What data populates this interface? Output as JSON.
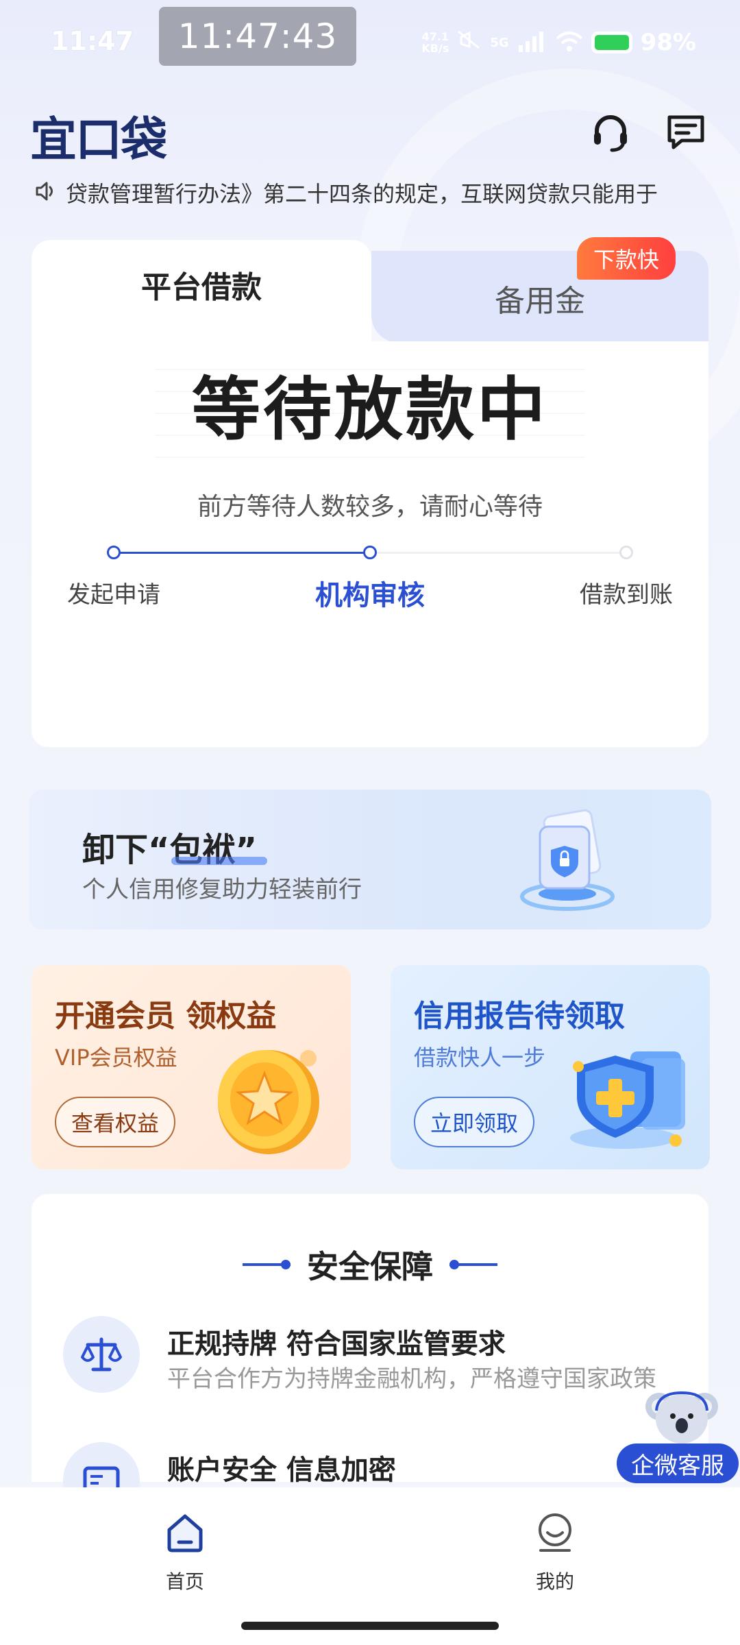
{
  "status_bar": {
    "time": "11:47",
    "clock_overlay": "11:47:43",
    "net_speed_value": "47.1",
    "net_speed_unit": "KB/s",
    "network": "5G",
    "battery": "98%"
  },
  "header": {
    "logo": "宜口袋",
    "icons": [
      "headset-icon",
      "message-icon"
    ]
  },
  "notice": {
    "text": "贷款管理暂行办法》第二十四条的规定，互联网贷款只能用于"
  },
  "loan_card": {
    "tabs": [
      {
        "label": "平台借款",
        "active": true
      },
      {
        "label": "备用金",
        "active": false,
        "badge": "下款快"
      }
    ],
    "status_title": "等待放款中",
    "status_subtitle": "前方等待人数较多，请耐心等待",
    "progress": {
      "steps": [
        "发起申请",
        "机构审核",
        "借款到账"
      ],
      "current_step": 2
    }
  },
  "banner": {
    "title": "卸下“包袱”",
    "subtitle": "个人信用修复助力轻装前行"
  },
  "promos": [
    {
      "title": "开通会员 领权益",
      "subtitle": "VIP会员权益",
      "button": "查看权益"
    },
    {
      "title": "信用报告待领取",
      "subtitle": "借款快人一步",
      "button": "立即领取"
    }
  ],
  "security": {
    "title": "安全保障",
    "items": [
      {
        "title": "正规持牌 符合国家监管要求",
        "desc": "平台合作方为持牌金融机构，严格遵守国家政策",
        "icon": "scale-icon"
      },
      {
        "title": "账户安全 信息加密",
        "desc": "",
        "icon": "id-card-icon"
      }
    ]
  },
  "float_service": {
    "label": "企微客服"
  },
  "bottom_nav": {
    "items": [
      {
        "label": "首页",
        "icon": "home-icon"
      },
      {
        "label": "我的",
        "icon": "profile-icon"
      }
    ]
  },
  "colors": {
    "primary": "#2b4fd3",
    "badge": "#ff4a3a",
    "vip_text": "#8a3a10"
  }
}
